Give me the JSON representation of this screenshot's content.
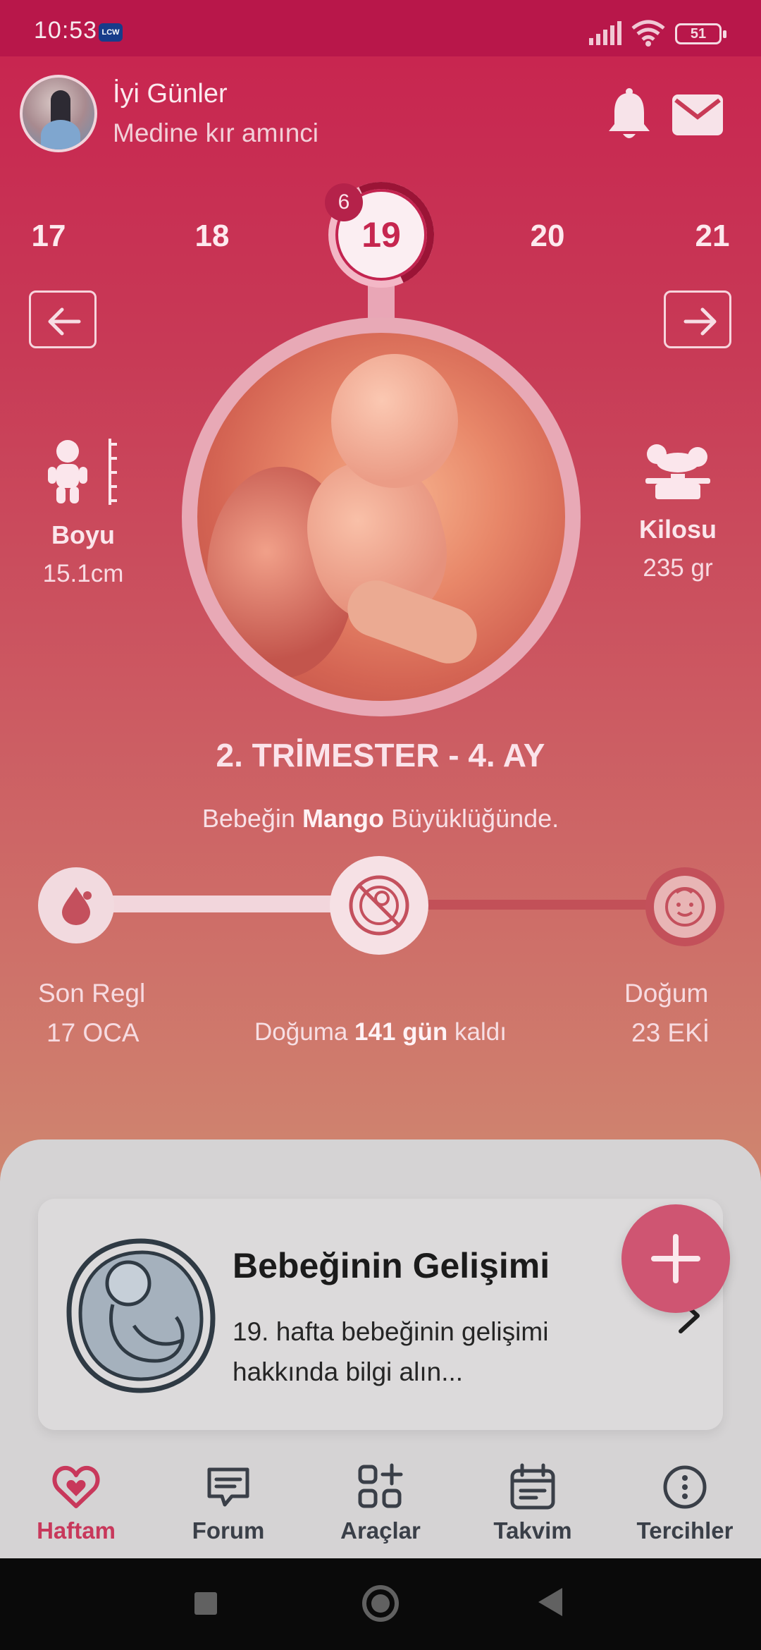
{
  "status_bar": {
    "time": "10:53",
    "carrier_badge": "LCW",
    "battery": "51"
  },
  "header": {
    "greeting": "İyi Günler",
    "user_name": "Medine kır amınci"
  },
  "weeks": {
    "items": [
      "17",
      "18",
      "19",
      "20",
      "21"
    ],
    "current": "19",
    "day_badge": "6"
  },
  "stats": {
    "height_label": "Boyu",
    "height_value": "15.1cm",
    "weight_label": "Kilosu",
    "weight_value": "235 gr"
  },
  "trimester": "2. TRİMESTER - 4. AY",
  "size": {
    "prefix": "Bebeğin",
    "fruit": "Mango",
    "suffix": "Büyüklüğünde."
  },
  "timeline": {
    "start_label": "Son Regl",
    "start_date": "17 OCA",
    "end_label": "Doğum",
    "end_date": "23 EKİ",
    "countdown_prefix": "Doğuma",
    "countdown_value": "141 gün",
    "countdown_suffix": "kaldı",
    "progress_fraction": 0.47
  },
  "card": {
    "title": "Bebeğinin Gelişimi",
    "description": "19. hafta bebeğinin gelişimi hakkında bilgi alın..."
  },
  "tabs": [
    {
      "label": "Haftam",
      "icon": "heart-icon",
      "active": true
    },
    {
      "label": "Forum",
      "icon": "chat-icon",
      "active": false
    },
    {
      "label": "Araçlar",
      "icon": "grid-plus-icon",
      "active": false
    },
    {
      "label": "Takvim",
      "icon": "calendar-icon",
      "active": false
    },
    {
      "label": "Tercihler",
      "icon": "more-icon",
      "active": false
    }
  ],
  "colors": {
    "brand": "#c8224f",
    "accent": "#cf5572",
    "tab_active": "#c8385b"
  }
}
